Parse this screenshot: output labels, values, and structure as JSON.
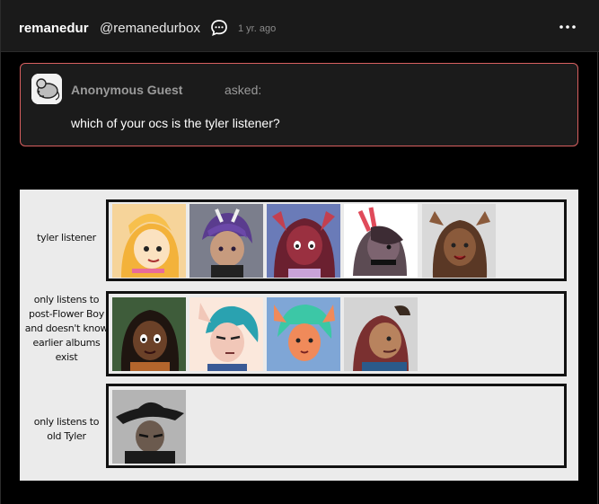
{
  "post": {
    "username": "remanedur",
    "handle": "@remanedurbox",
    "time": "1 yr. ago"
  },
  "ask": {
    "asker": "Anonymous Guest",
    "asked_word": "asked:",
    "question": "which of your ocs is the tyler listener?"
  },
  "tier_list": {
    "rows": [
      {
        "label": "tyler listener",
        "count": 5
      },
      {
        "label": "only listens to post-Flower Boy and doesn't know earlier albums exist",
        "count": 4
      },
      {
        "label": "only listens to old Tyler",
        "count": 1
      }
    ],
    "label_lines": {
      "r0": [
        "tyler listener"
      ],
      "r1": [
        "only listens to",
        "post-Flower Boy",
        "and doesn't know",
        "earlier albums",
        "exist"
      ],
      "r2": [
        "only listens to",
        "old Tyler"
      ]
    }
  },
  "icons": {
    "chat": "speech-bubble-icon",
    "more": "more-dots-icon",
    "avatar": "anonymous-mouse-avatar"
  },
  "colors": {
    "ask_border": "#d86060",
    "header_bg": "#1a1a1a",
    "tier_bg": "#ebebeb"
  }
}
